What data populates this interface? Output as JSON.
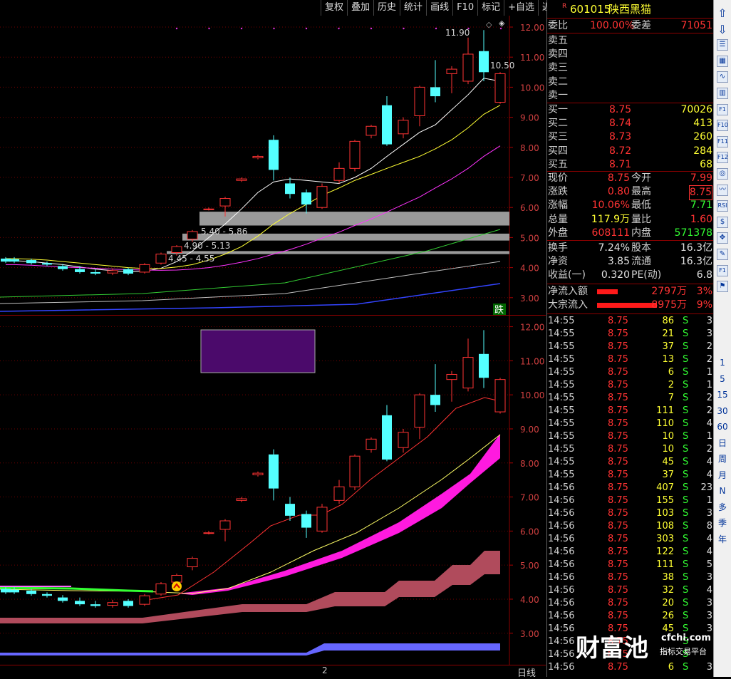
{
  "toolbar": {
    "items": [
      "复权",
      "叠加",
      "历史",
      "统计",
      "画线",
      "F10",
      "标记",
      "+自选",
      "返回"
    ]
  },
  "upper_chart": {
    "price_axis": [
      "12.00",
      "11.00",
      "10.00",
      "9.00",
      "8.00",
      "7.00",
      "6.00",
      "5.00",
      "4.00",
      "3.00"
    ],
    "high_label": "11.90",
    "close_label": "10.50",
    "zones": [
      "5.40 - 5.86",
      "4.90 - 5.13",
      "4.45 - 4.55"
    ],
    "badge": "跌"
  },
  "lower_chart": {
    "price_axis": [
      "12.00",
      "11.00",
      "10.00",
      "9.00",
      "8.00",
      "7.00",
      "6.00",
      "5.00",
      "4.00",
      "3.00"
    ]
  },
  "bottom": {
    "date_marker": "2",
    "period": "日线"
  },
  "quote": {
    "stock_code": "601015",
    "stock_name": "陕西黑猫",
    "r_mark": "R",
    "weibi_label": "委比",
    "weibi": "100.00%",
    "weicha_label": "委差",
    "weicha": "71051",
    "asks": [
      {
        "label": "卖五"
      },
      {
        "label": "卖四"
      },
      {
        "label": "卖三"
      },
      {
        "label": "卖二"
      },
      {
        "label": "卖一"
      }
    ],
    "bids": [
      {
        "label": "买一",
        "price": "8.75",
        "vol": "70026"
      },
      {
        "label": "买二",
        "price": "8.74",
        "vol": "413"
      },
      {
        "label": "买三",
        "price": "8.73",
        "vol": "260"
      },
      {
        "label": "买四",
        "price": "8.72",
        "vol": "284"
      },
      {
        "label": "买五",
        "price": "8.71",
        "vol": "68"
      }
    ],
    "stats": [
      {
        "l1": "现价",
        "v1": "8.75",
        "l2": "今开",
        "v2": "7.99"
      },
      {
        "l1": "涨跌",
        "v1": "0.80",
        "l2": "最高",
        "v2": "8.75"
      },
      {
        "l1": "涨幅",
        "v1": "10.06%",
        "l2": "最低",
        "v2": "7.71"
      },
      {
        "l1": "总量",
        "v1": "117.9万",
        "l2": "量比",
        "v2": "1.60"
      },
      {
        "l1": "外盘",
        "v1": "608111",
        "l2": "内盘",
        "v2": "571378"
      }
    ],
    "stats2": [
      {
        "l1": "换手",
        "v1": "7.24%",
        "l2": "股本",
        "v2": "16.3亿"
      },
      {
        "l1": "净资",
        "v1": "3.85",
        "l2": "流通",
        "v2": "16.3亿"
      },
      {
        "l1": "收益(一)",
        "v1": "0.320",
        "l2": "PE(动)",
        "v2": "6.8"
      }
    ],
    "flows": [
      {
        "label": "净流入额",
        "value": "2797万",
        "pct": "3%",
        "bar": 0.35
      },
      {
        "label": "大宗流入",
        "value": "8975万",
        "pct": "9%",
        "bar": 1.0
      }
    ]
  },
  "ticks": [
    {
      "t": "14:55",
      "p": "8.75",
      "v": "86",
      "s": "S",
      "n": "3"
    },
    {
      "t": "14:55",
      "p": "8.75",
      "v": "21",
      "s": "S",
      "n": "3"
    },
    {
      "t": "14:55",
      "p": "8.75",
      "v": "37",
      "s": "S",
      "n": "2"
    },
    {
      "t": "14:55",
      "p": "8.75",
      "v": "13",
      "s": "S",
      "n": "2"
    },
    {
      "t": "14:55",
      "p": "8.75",
      "v": "6",
      "s": "S",
      "n": "1"
    },
    {
      "t": "14:55",
      "p": "8.75",
      "v": "2",
      "s": "S",
      "n": "1"
    },
    {
      "t": "14:55",
      "p": "8.75",
      "v": "7",
      "s": "S",
      "n": "2"
    },
    {
      "t": "14:55",
      "p": "8.75",
      "v": "111",
      "s": "S",
      "n": "2"
    },
    {
      "t": "14:55",
      "p": "8.75",
      "v": "110",
      "s": "S",
      "n": "4"
    },
    {
      "t": "14:55",
      "p": "8.75",
      "v": "10",
      "s": "S",
      "n": "1"
    },
    {
      "t": "14:55",
      "p": "8.75",
      "v": "10",
      "s": "S",
      "n": "2"
    },
    {
      "t": "14:55",
      "p": "8.75",
      "v": "45",
      "s": "S",
      "n": "4"
    },
    {
      "t": "14:55",
      "p": "8.75",
      "v": "37",
      "s": "S",
      "n": "4"
    },
    {
      "t": "14:56",
      "p": "8.75",
      "v": "407",
      "s": "S",
      "n": "23"
    },
    {
      "t": "14:56",
      "p": "8.75",
      "v": "155",
      "s": "S",
      "n": "1"
    },
    {
      "t": "14:56",
      "p": "8.75",
      "v": "103",
      "s": "S",
      "n": "3"
    },
    {
      "t": "14:56",
      "p": "8.75",
      "v": "108",
      "s": "S",
      "n": "8"
    },
    {
      "t": "14:56",
      "p": "8.75",
      "v": "303",
      "s": "S",
      "n": "4"
    },
    {
      "t": "14:56",
      "p": "8.75",
      "v": "122",
      "s": "S",
      "n": "4"
    },
    {
      "t": "14:56",
      "p": "8.75",
      "v": "111",
      "s": "S",
      "n": "5"
    },
    {
      "t": "14:56",
      "p": "8.75",
      "v": "38",
      "s": "S",
      "n": "3"
    },
    {
      "t": "14:56",
      "p": "8.75",
      "v": "32",
      "s": "S",
      "n": "4"
    },
    {
      "t": "14:56",
      "p": "8.75",
      "v": "20",
      "s": "S",
      "n": "3"
    },
    {
      "t": "14:56",
      "p": "8.75",
      "v": "26",
      "s": "S",
      "n": "3"
    },
    {
      "t": "14:56",
      "p": "8.75",
      "v": "45",
      "s": "S",
      "n": "3"
    },
    {
      "t": "14:56",
      "p": "8.75",
      "v": "",
      "s": "S",
      "n": ""
    },
    {
      "t": "14:56",
      "p": "8.75",
      "v": "",
      "s": "S",
      "n": ""
    },
    {
      "t": "14:56",
      "p": "8.75",
      "v": "6",
      "s": "S",
      "n": "3"
    }
  ],
  "watermark": {
    "main": "财富池",
    "site": "cfchi.com",
    "sub": "指标交易平台"
  },
  "side_strip": [
    "1",
    "5",
    "15",
    "30",
    "60",
    "日",
    "周",
    "月",
    "N",
    "多",
    "季",
    "年"
  ],
  "side_icons": [
    "arrow-up-icon",
    "arrow-down-icon",
    "list-icon",
    "table-icon",
    "line-chart-icon",
    "candle-icon",
    "f1-icon",
    "f10-icon",
    "f11-icon",
    "f12-icon",
    "circle-icon",
    "wave-icon",
    "rsi-icon",
    "dollar-icon",
    "move-icon",
    "pencil-icon",
    "f1-alt-icon",
    "flag-icon"
  ],
  "colors": {
    "up": "#ff3333",
    "down": "#54ffff",
    "zone": "#9a9a9a",
    "ribbon": "#ff1adf",
    "cloud": "#b04b5c"
  }
}
